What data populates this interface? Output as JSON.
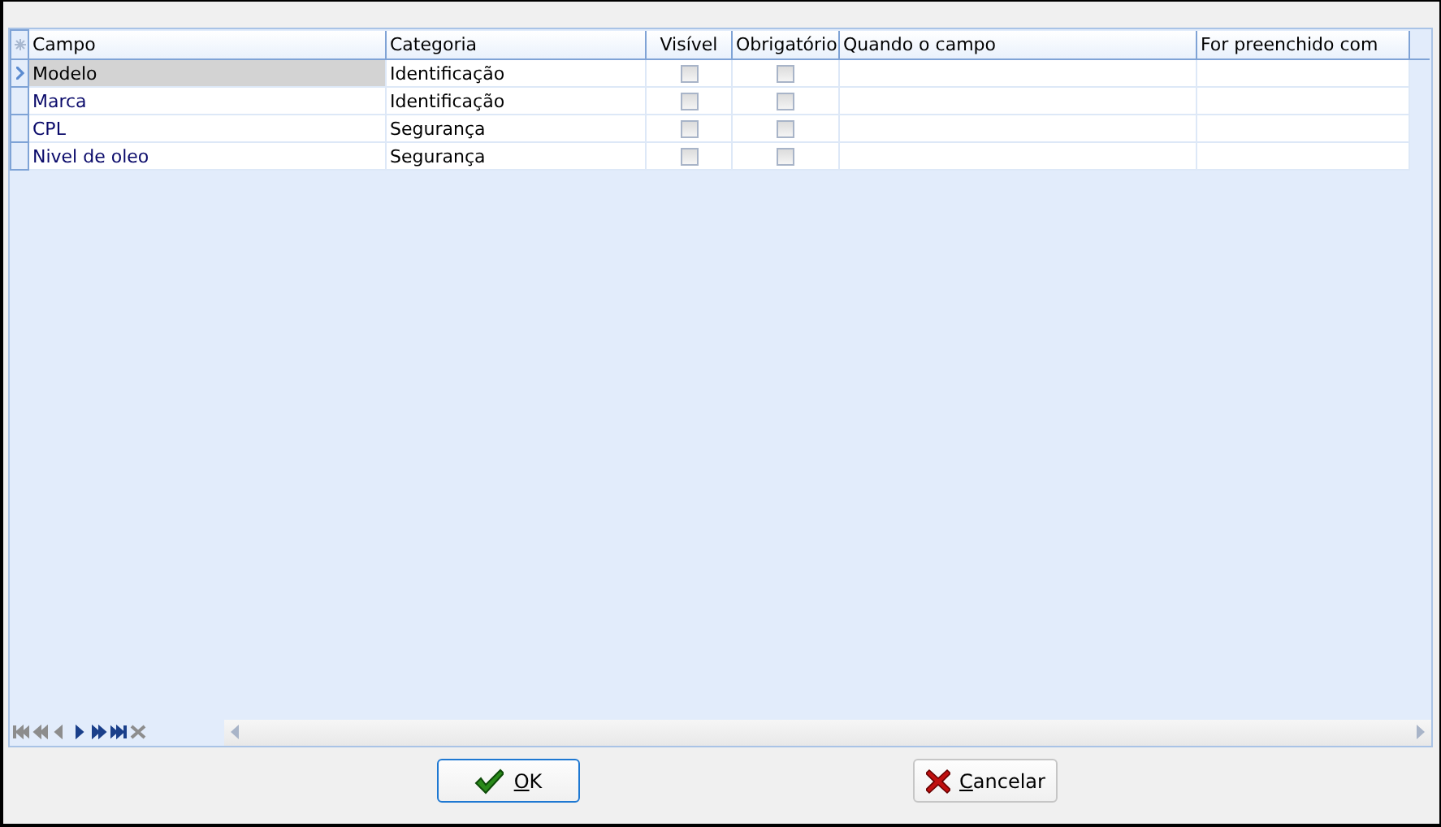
{
  "grid": {
    "columns": [
      "Campo",
      "Categoria",
      "Visível",
      "Obrigatório",
      "Quando o campo",
      "For preenchido com"
    ],
    "rows": [
      {
        "campo": "Modelo",
        "categoria": "Identificação",
        "visivel": false,
        "obrigatorio": false,
        "selected": true
      },
      {
        "campo": "Marca",
        "categoria": "Identificação",
        "visivel": false,
        "obrigatorio": false,
        "selected": false
      },
      {
        "campo": "CPL",
        "categoria": "Segurança",
        "visivel": false,
        "obrigatorio": false,
        "selected": false
      },
      {
        "campo": "Nivel de oleo",
        "categoria": "Segurança",
        "visivel": false,
        "obrigatorio": false,
        "selected": false
      }
    ],
    "navigator": [
      {
        "kind": "first",
        "disabled": true
      },
      {
        "kind": "prev-page",
        "disabled": true
      },
      {
        "kind": "prev",
        "disabled": true
      },
      {
        "kind": "next",
        "disabled": false
      },
      {
        "kind": "next-page",
        "disabled": false
      },
      {
        "kind": "last",
        "disabled": false
      },
      {
        "kind": "delete",
        "disabled": true
      }
    ]
  },
  "buttons": [
    {
      "kind": "ok",
      "label": "OK",
      "focused": true
    },
    {
      "kind": "cancel",
      "label": "Cancelar",
      "focused": false
    }
  ]
}
